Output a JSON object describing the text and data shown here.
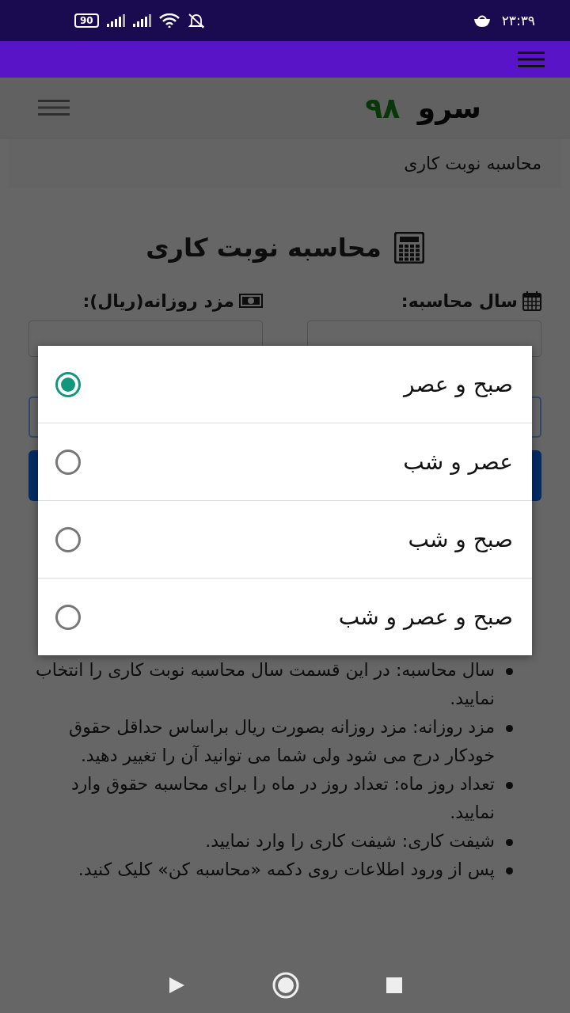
{
  "status_bar": {
    "time": "۲۳:۳۹",
    "battery": "90"
  },
  "header": {
    "logo_word": "سرو",
    "logo_number": "۹۸"
  },
  "breadcrumb": "محاسبه نوبت کاری",
  "page_title": "محاسبه نوبت کاری",
  "form": {
    "labels": [
      {
        "kind": "calendar",
        "text": "سال محاسبه:"
      },
      {
        "kind": "money",
        "text": "مزد روزانه(ریال):"
      }
    ]
  },
  "dialog": {
    "options": [
      {
        "label": "صبح و عصر",
        "selected": true
      },
      {
        "label": "عصر و شب",
        "selected": false
      },
      {
        "label": "صبح و شب",
        "selected": false
      },
      {
        "label": "صبح و عصر و شب",
        "selected": false
      }
    ]
  },
  "help_items": [
    "سال محاسبه: در این قسمت سال محاسبه نوبت کاری را انتخاب نمایید.",
    "مزد روزانه: مزد روزانه بصورت ریال براساس حداقل حقوق خودکار درج می شود ولی شما می توانید آن را تغییر دهید.",
    "تعداد روز ماه: تعداد روز در ماه را برای محاسبه حقوق وارد نمایید.",
    "شیفت کاری: شیفت کاری را وارد نمایید.",
    "پس از ورود اطلاعات روی دکمه «محاسبه کن» کلیک کنید."
  ]
}
